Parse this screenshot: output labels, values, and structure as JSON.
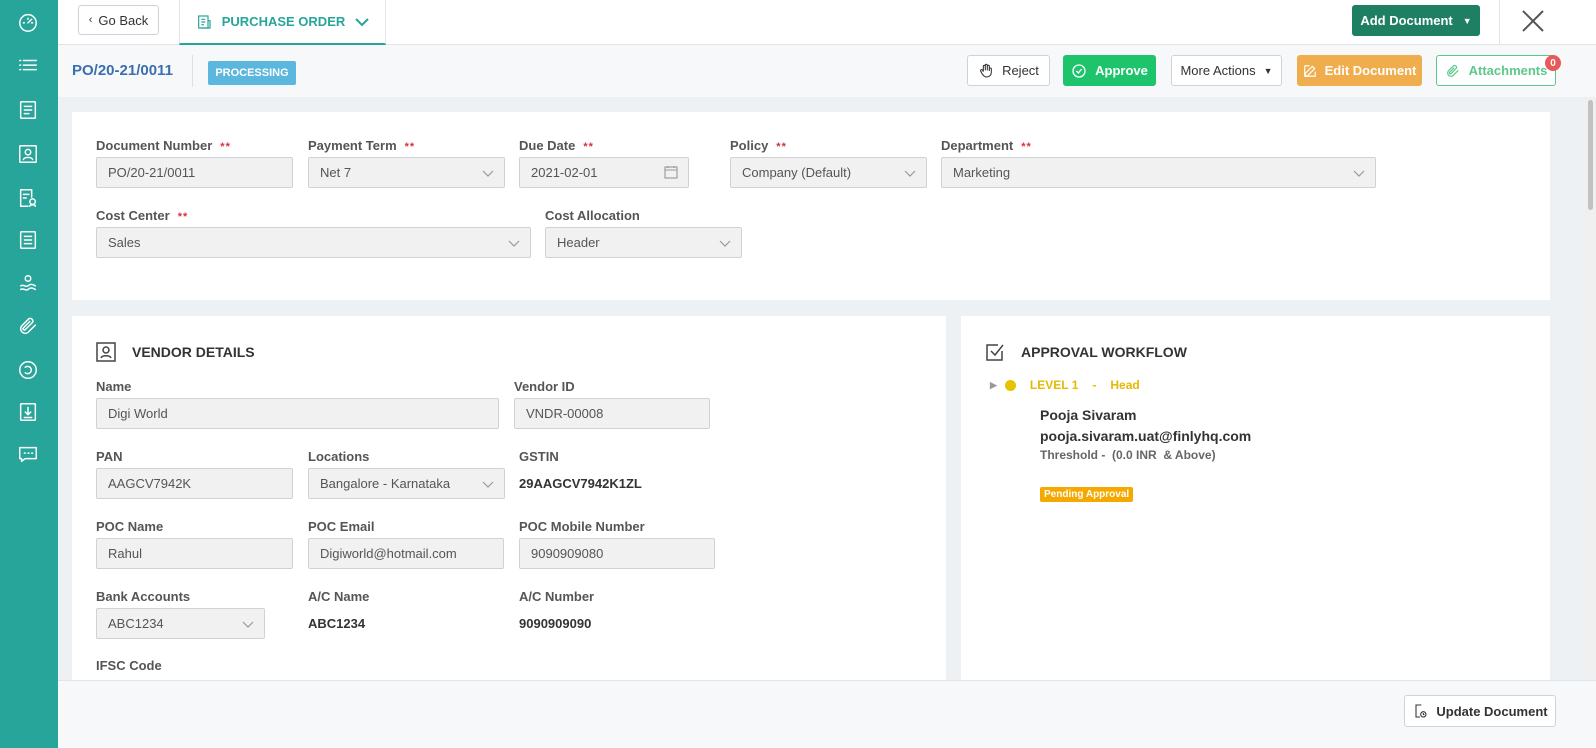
{
  "topbar": {
    "go_back": "Go Back",
    "tab_label": "PURCHASE ORDER",
    "add_document": "Add Document"
  },
  "subheader": {
    "doc_number": "PO/20-21/0011",
    "status": "PROCESSING",
    "reject": "Reject",
    "approve": "Approve",
    "more_actions": "More Actions",
    "edit_document": "Edit Document",
    "attachments": "Attachments",
    "attachments_count": "0"
  },
  "header_fields": {
    "document_number": {
      "label": "Document Number",
      "value": "PO/20-21/0011"
    },
    "payment_term": {
      "label": "Payment Term",
      "value": "Net 7"
    },
    "due_date": {
      "label": "Due Date",
      "value": "2021-02-01"
    },
    "policy": {
      "label": "Policy",
      "value": "Company (Default)"
    },
    "department": {
      "label": "Department",
      "value": "Marketing"
    },
    "cost_center": {
      "label": "Cost Center",
      "value": "Sales"
    },
    "cost_allocation": {
      "label": "Cost Allocation",
      "value": "Header"
    },
    "required_mark": "**"
  },
  "vendor": {
    "title": "VENDOR DETAILS",
    "name": {
      "label": "Name",
      "value": "Digi World"
    },
    "vendor_id": {
      "label": "Vendor ID",
      "value": "VNDR-00008"
    },
    "pan": {
      "label": "PAN",
      "value": "AAGCV7942K"
    },
    "locations": {
      "label": "Locations",
      "value": "Bangalore - Karnataka"
    },
    "gstin": {
      "label": "GSTIN",
      "value": "29AAGCV7942K1ZL"
    },
    "poc_name": {
      "label": "POC Name",
      "value": "Rahul"
    },
    "poc_email": {
      "label": "POC Email",
      "value": "Digiworld@hotmail.com"
    },
    "poc_mobile": {
      "label": "POC Mobile Number",
      "value": "9090909080"
    },
    "bank_accounts": {
      "label": "Bank Accounts",
      "value": "ABC1234"
    },
    "ac_name": {
      "label": "A/C Name",
      "value": "ABC1234"
    },
    "ac_number": {
      "label": "A/C Number",
      "value": "9090909090"
    },
    "ifsc": {
      "label": "IFSC Code"
    }
  },
  "approval": {
    "title": "APPROVAL WORKFLOW",
    "level": "LEVEL 1",
    "separator": "-",
    "role": "Head",
    "approver_name": "Pooja Sivaram",
    "approver_email": "pooja.sivaram.uat@finlyhq.com",
    "threshold": "Threshold -  (0.0 INR  & Above)",
    "status": "Pending Approval",
    "status_color": "#f5a800"
  },
  "bottom": {
    "update_document": "Update Document"
  },
  "colors": {
    "sidebar": "#28a59a",
    "primary": "#1f7f62",
    "approve": "#1ec46b",
    "edit": "#f0ad4e",
    "link": "#3a6fb0"
  }
}
